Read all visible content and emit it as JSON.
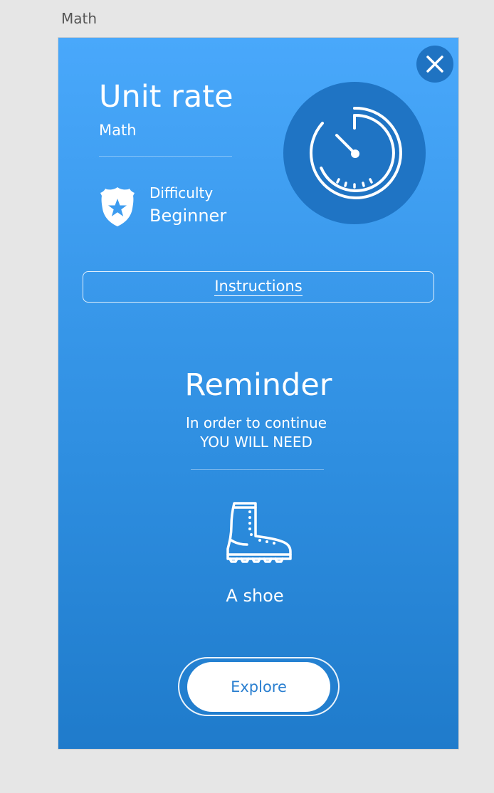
{
  "artboard": {
    "label": "Math"
  },
  "header": {
    "title": "Unit rate",
    "subject": "Math"
  },
  "difficulty": {
    "label": "Difficulty",
    "value": "Beginner"
  },
  "instructions": {
    "label": "Instructions"
  },
  "reminder": {
    "title": "Reminder",
    "line1": "In order to continue",
    "line2": "YOU WILL NEED"
  },
  "requirement": {
    "item": "A shoe"
  },
  "actions": {
    "explore_label": "Explore"
  },
  "icons": {
    "close": "close-icon",
    "badge": "police-badge-star-icon",
    "timer": "stopwatch-timer-icon",
    "boot": "boot-icon"
  },
  "colors": {
    "gradient_top": "#49a8fb",
    "gradient_bottom": "#1f7bcb",
    "dark_circle": "#1f74c4",
    "button_text": "#2a7fd0"
  }
}
